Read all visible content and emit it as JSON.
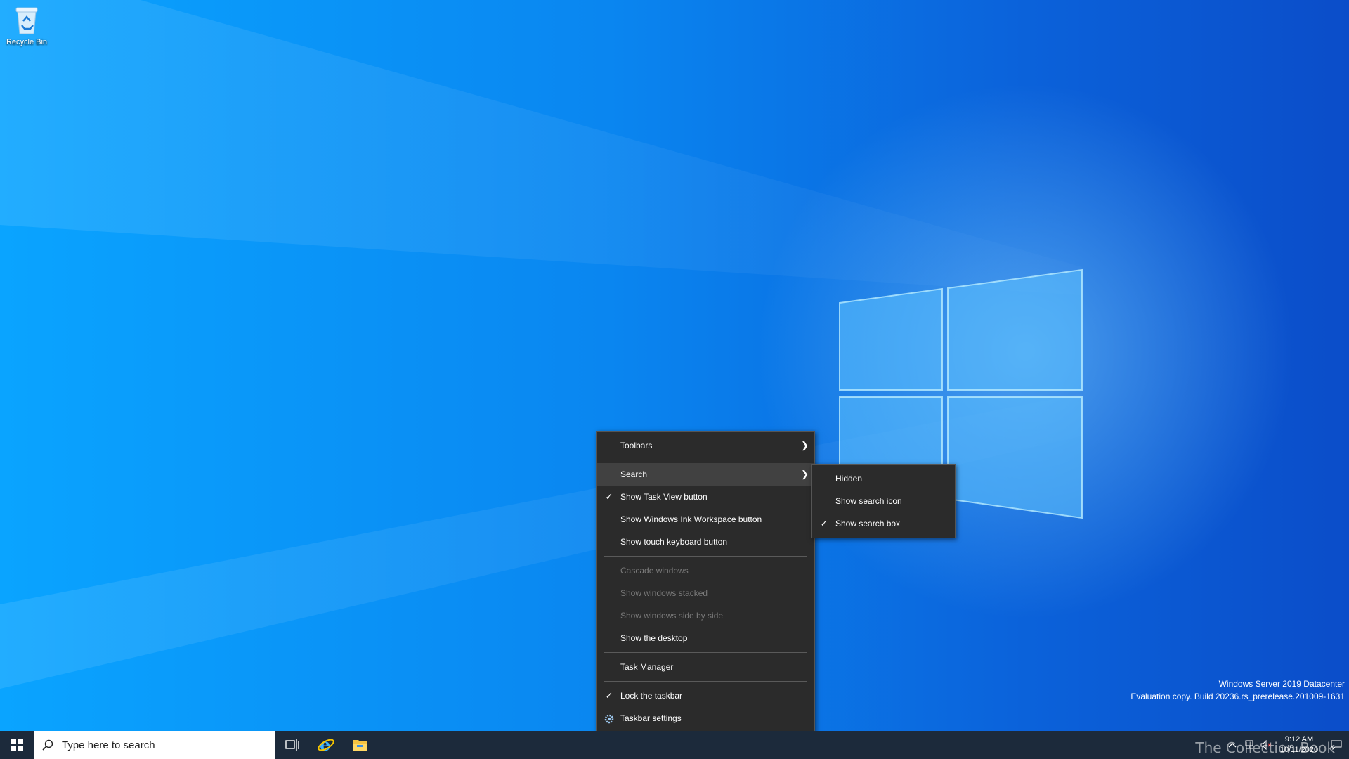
{
  "desktop": {
    "icons": [
      {
        "label": "Recycle Bin",
        "icon": "recycle-bin-icon"
      }
    ]
  },
  "watermark": {
    "line1": "Windows Server 2019 Datacenter",
    "line2": "Evaluation copy. Build 20236.rs_prerelease.201009-1631",
    "overlay": "The Collection Book"
  },
  "taskbar": {
    "search_placeholder": "Type here to search",
    "pinned": [
      "task-view-icon",
      "internet-explorer-icon",
      "file-explorer-icon"
    ],
    "clock_time": "9:12 AM",
    "clock_date": "10/11/2020"
  },
  "context_menu": {
    "items": [
      {
        "label": "Toolbars",
        "submenu": true
      },
      {
        "label": "Search",
        "submenu": true,
        "highlighted": true
      },
      {
        "label": "Show Task View button",
        "checked": true
      },
      {
        "label": "Show Windows Ink Workspace button"
      },
      {
        "label": "Show touch keyboard button"
      },
      {
        "label": "Cascade windows",
        "disabled": true
      },
      {
        "label": "Show windows stacked",
        "disabled": true
      },
      {
        "label": "Show windows side by side",
        "disabled": true
      },
      {
        "label": "Show the desktop"
      },
      {
        "label": "Task Manager"
      },
      {
        "label": "Lock the taskbar",
        "checked": true
      },
      {
        "label": "Taskbar settings",
        "icon": "gear-icon"
      }
    ]
  },
  "search_submenu": {
    "items": [
      {
        "label": "Hidden"
      },
      {
        "label": "Show search icon"
      },
      {
        "label": "Show search box",
        "checked": true
      }
    ]
  }
}
